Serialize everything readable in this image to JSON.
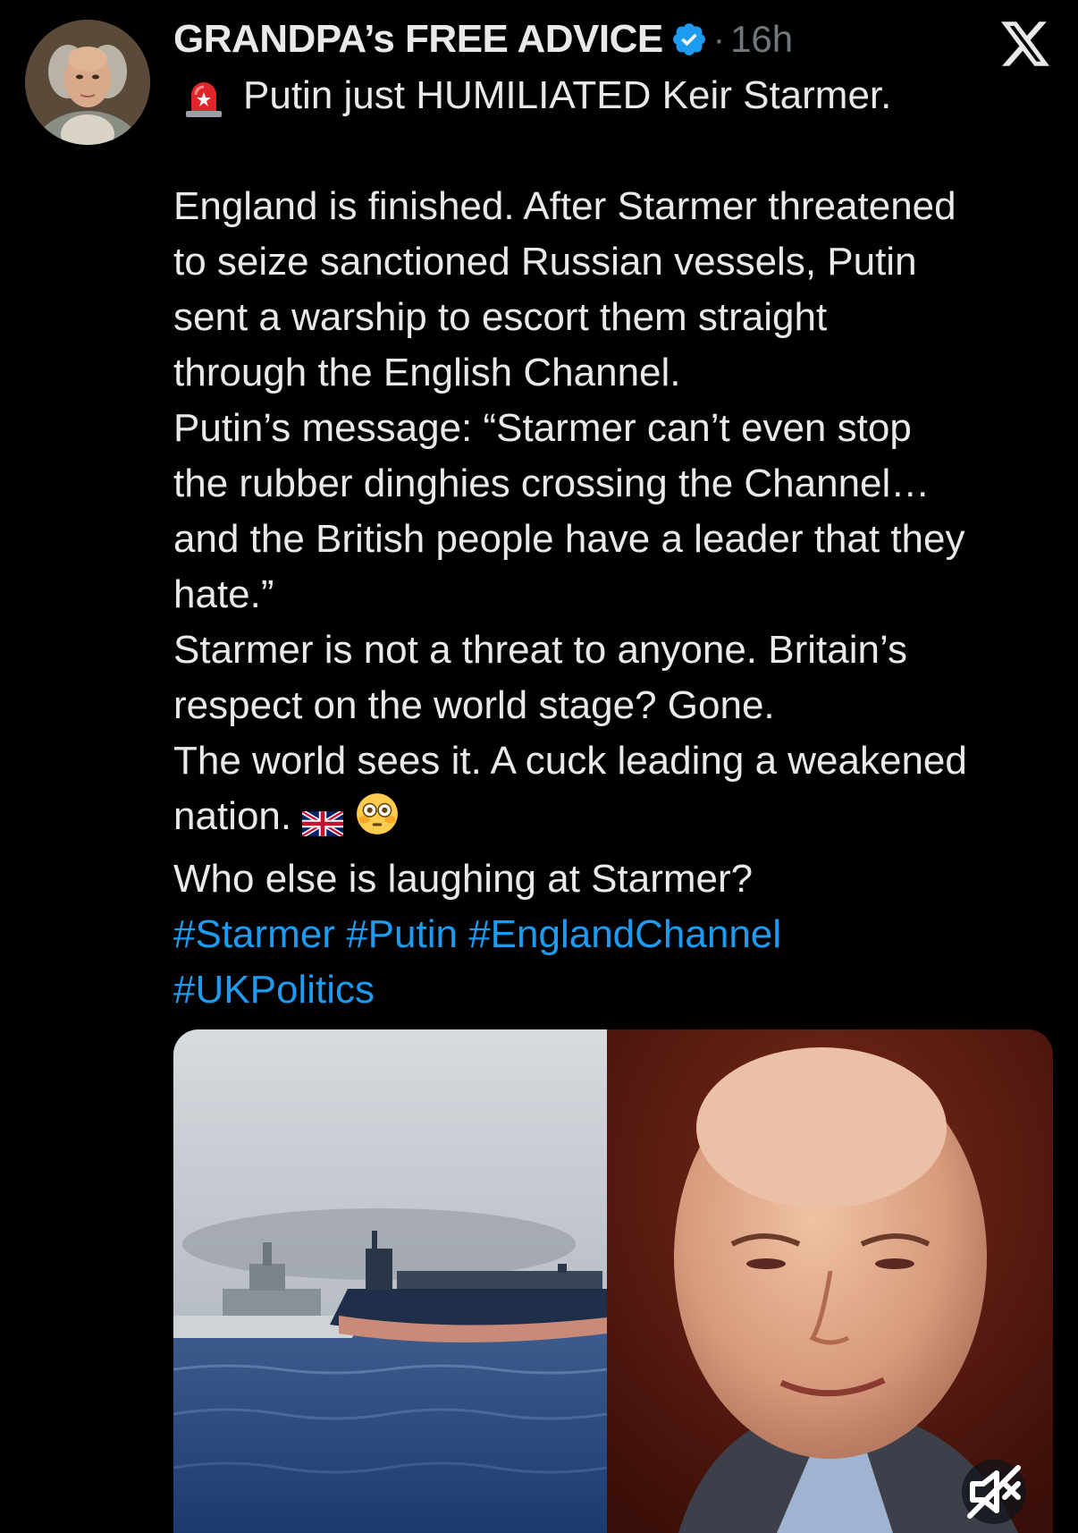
{
  "author": {
    "name": "GRANDPA’s FREE ADVICE",
    "dot": "·",
    "time": "16h"
  },
  "tweet": {
    "line1": "Putin just HUMILIATED Keir Starmer.",
    "body_lines": [
      "England is finished. After Starmer threatened",
      "to seize sanctioned Russian vessels, Putin",
      "sent a warship to escort them straight",
      "through the English Channel.",
      "Putin’s message: “Starmer can’t even stop",
      "the rubber dinghies crossing the Channel…",
      "and the British people have a leader that they",
      "hate.”",
      "Starmer is not a threat to anyone. Britain’s",
      "respect on the world stage? Gone.",
      "The world sees it. A cuck leading a weakened"
    ],
    "nation_text": "nation.",
    "last_line": "Who else is laughing at Starmer?",
    "hashtags_line1": [
      "#Starmer",
      "#Putin",
      "#EnglandChannel"
    ],
    "hashtags_line2": [
      "#UKPolitics"
    ]
  },
  "icons": {
    "siren": "police-siren-emoji",
    "flag": "uk-flag-emoji",
    "flushed": "flushed-face-emoji",
    "verified": "verified-badge-icon",
    "logo": "x-logo-icon",
    "mute": "muted-speaker-icon"
  },
  "colors": {
    "background": "#000000",
    "text": "#e7e9ea",
    "secondary": "#71767b",
    "link": "#1d9bf0",
    "verified": "#1d9bf0"
  }
}
